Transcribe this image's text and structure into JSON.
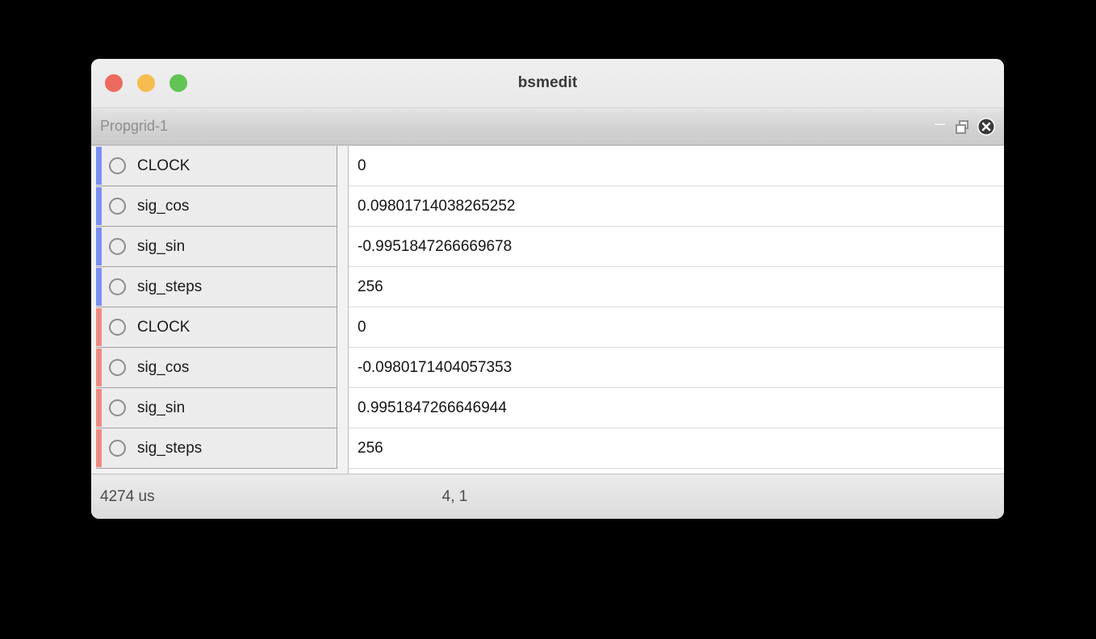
{
  "window": {
    "title": "bsmedit",
    "traffic_lights": [
      {
        "name": "close",
        "color": "#ec6a5e"
      },
      {
        "name": "minimize",
        "color": "#f5bd4f"
      },
      {
        "name": "zoom",
        "color": "#61c454"
      }
    ]
  },
  "mdi": {
    "title": "Propgrid-1",
    "controls": [
      {
        "name": "minimize",
        "glyph": "minimize-icon"
      },
      {
        "name": "restore",
        "glyph": "restore-icon"
      },
      {
        "name": "close",
        "glyph": "close-icon"
      }
    ]
  },
  "grid": {
    "rows": [
      {
        "name": "CLOCK",
        "value": "0",
        "accent": "#7b8ef0",
        "group": 1
      },
      {
        "name": "sig_cos",
        "value": "0.09801714038265252",
        "accent": "#7b8ef0",
        "group": 1
      },
      {
        "name": "sig_sin",
        "value": "-0.9951847266669678",
        "accent": "#7b8ef0",
        "group": 1
      },
      {
        "name": "sig_steps",
        "value": "256",
        "accent": "#7b8ef0",
        "group": 1
      },
      {
        "name": "CLOCK",
        "value": "0",
        "accent": "#ef8a80",
        "group": 2
      },
      {
        "name": "sig_cos",
        "value": "-0.0980171404057353",
        "accent": "#ef8a80",
        "group": 2
      },
      {
        "name": "sig_sin",
        "value": "0.9951847266646944",
        "accent": "#ef8a80",
        "group": 2
      },
      {
        "name": "sig_steps",
        "value": "256",
        "accent": "#ef8a80",
        "group": 2
      }
    ]
  },
  "statusbar": {
    "left": "4274 us",
    "center": "4, 1"
  }
}
